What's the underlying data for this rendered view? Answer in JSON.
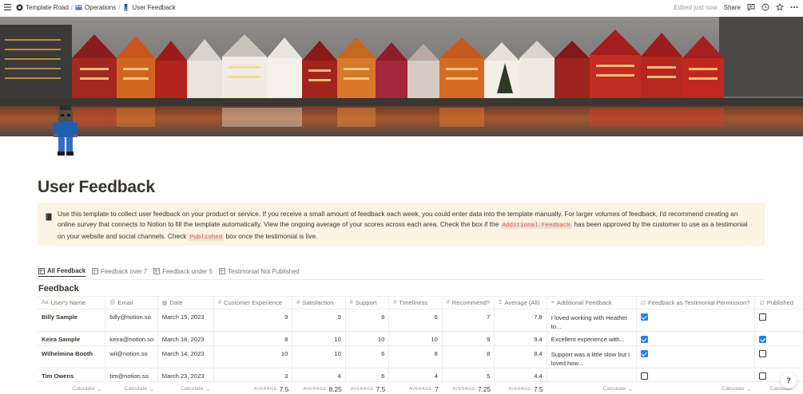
{
  "breadcrumbs": [
    {
      "label": "Template Road"
    },
    {
      "label": "Operations"
    },
    {
      "label": "User Feedback"
    }
  ],
  "topbar": {
    "edited": "Edited just now",
    "share": "Share"
  },
  "page": {
    "title": "User Feedback",
    "callout": {
      "text_1": "Use this template to collect user feedback on your product or service. If you receive a small amount of feedback each week, you could enter data into the template manually. For larger volumes of feedback, I'd recommend creating an online survey that connects to Notion to fill the template automatically. View the ongoing average of your scores across each area. Check the box if the ",
      "code_1": "Additional Feedback",
      "text_2": " has been approved by the customer to use as a testimonial on your website and social channels. Check ",
      "code_2": "Published",
      "text_3": " box once the testimonial is live."
    }
  },
  "tabs": [
    {
      "label": "All Feedback",
      "active": true
    },
    {
      "label": "Feedback over 7",
      "active": false
    },
    {
      "label": "Feedback under 5",
      "active": false
    },
    {
      "label": "Testimonial Not Published",
      "active": false
    }
  ],
  "database": {
    "title": "Feedback",
    "columns": [
      {
        "icon": "Aa",
        "label": "User's Name"
      },
      {
        "icon": "@",
        "label": "Email"
      },
      {
        "icon": "▦",
        "label": "Date"
      },
      {
        "icon": "#",
        "label": "Customer Experience"
      },
      {
        "icon": "#",
        "label": "Satisfaction"
      },
      {
        "icon": "#",
        "label": "Support"
      },
      {
        "icon": "#",
        "label": "Timeliness"
      },
      {
        "icon": "#",
        "label": "Recommend?"
      },
      {
        "icon": "Σ",
        "label": "Average (All)"
      },
      {
        "icon": "≡",
        "label": "Additional Feedback"
      },
      {
        "icon": "☑",
        "label": "Feedback as Testimonial Permission?"
      },
      {
        "icon": "☑",
        "label": "Published"
      }
    ],
    "rows": [
      {
        "name": "Billy Sample",
        "email": "billy@notion.so",
        "date": "March 15, 2023",
        "cx": "9",
        "sat": "9",
        "sup": "8",
        "time": "6",
        "rec": "7",
        "avg": "7.8",
        "feedback": "I loved working with Heather to...",
        "permission": true,
        "published": false
      },
      {
        "name": "Keira Sample",
        "email": "keira@notion.so",
        "date": "March 18, 2023",
        "cx": "8",
        "sat": "10",
        "sup": "10",
        "time": "10",
        "rec": "9",
        "avg": "9.4",
        "feedback": "Excellent experience with...",
        "permission": true,
        "published": true
      },
      {
        "name": "Wilhelmina Booth",
        "email": "wil@notion.so",
        "date": "March 14, 2023",
        "cx": "10",
        "sat": "10",
        "sup": "6",
        "time": "8",
        "rec": "8",
        "avg": "8.4",
        "feedback": "Support was a little slow but I loved how...",
        "permission": true,
        "published": false
      },
      {
        "name": "Tim Owens",
        "email": "tim@notion.so",
        "date": "March 23, 2023",
        "cx": "3",
        "sat": "4",
        "sup": "6",
        "time": "4",
        "rec": "5",
        "avg": "4.4",
        "feedback": "",
        "permission": false,
        "published": false
      }
    ],
    "calculations": [
      {
        "label": "Calculate",
        "value": ""
      },
      {
        "label": "Calculate",
        "value": ""
      },
      {
        "label": "Calculate",
        "value": ""
      },
      {
        "label": "AVERAGE",
        "value": "7.5"
      },
      {
        "label": "AVERAGE",
        "value": "8.25"
      },
      {
        "label": "AVERAGE",
        "value": "7.5"
      },
      {
        "label": "AVERAGE",
        "value": "7"
      },
      {
        "label": "AVERAGE",
        "value": "7.25"
      },
      {
        "label": "AVERAGE",
        "value": "7.5"
      },
      {
        "label": "Calculate",
        "value": ""
      },
      {
        "label": "Calculate",
        "value": ""
      },
      {
        "label": "Calculate",
        "value": ""
      }
    ]
  },
  "help": "?",
  "colors": {
    "accent": "#2383e2",
    "callout_bg": "#fbf3e4",
    "code_text": "#eb5757",
    "text": "#37352f",
    "muted": "#787774"
  }
}
